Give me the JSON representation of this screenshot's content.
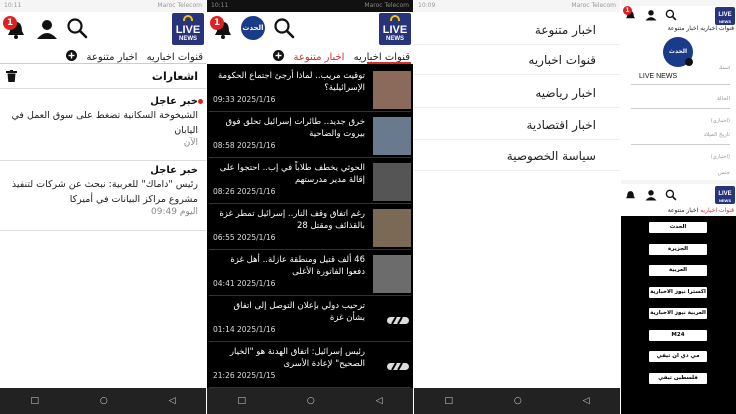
{
  "status": {
    "time1": "10:11",
    "carrier": "Maroc Telecom",
    "time3": "10:09"
  },
  "logo": {
    "line1": "LIVE",
    "line2": "NEWS"
  },
  "badge": "1",
  "tabs": {
    "varied": "اخبار متنوعة",
    "channels": "قنوات اخباريه"
  },
  "notifications": {
    "title": "اشعارات",
    "items": [
      {
        "label": "خبر عاجل",
        "body": "الشيخوخة السكانية تضغط على سوق العمل في اليابان",
        "time": "الآن"
      },
      {
        "label": "خبر عاجل",
        "body": "رئيس \"داماك\" للعربية: نبحث عن شركات لتنفيذ مشروع مراكز البيانات في أميركا",
        "time": "اليوم 09:49"
      }
    ]
  },
  "news": [
    {
      "title": "توقيت مريب.. لماذا أرجئ اجتماع الحكومة الإسرائيلية؟",
      "time": "09:33 2025/1/16",
      "thumb": "#8a6a5a"
    },
    {
      "title": "خرق جديد.. طائرات إسرائيل تحلق فوق بيروت والضاحية",
      "time": "08:58 2025/1/16",
      "thumb": "#6a7a8e"
    },
    {
      "title": "الحوثي يخطف طلاباً في إب.. احتجوا على إقالة مدير مدرستهم",
      "time": "08:26 2025/1/16",
      "thumb": "#555555"
    },
    {
      "title": "رغم اتفاق وقف النار.. إسرائيل تمطر غزة بالقذائف ومقتل 28",
      "time": "06:55 2025/1/16",
      "thumb": "#7a6a55"
    },
    {
      "title": "46 ألف قتيل ومنطقة عازلة.. أهل غزة دفعوا الفاتورة الأغلى",
      "time": "04:41 2025/1/16",
      "thumb": "#6c6c6c"
    },
    {
      "title": "ترحيب دولي بإعلان التوصل إلى اتفاق بشأن غزة",
      "time": "01:14 2025/1/16",
      "thumb": ""
    },
    {
      "title": "رئيس إسرائيل: اتفاق الهدنة هو \"الخيار الصحيح\" لإعادة الأسرى",
      "time": "21:26 2025/1/15",
      "thumb": ""
    }
  ],
  "drawer": [
    "اخبار متنوعة",
    "قنوات اخباريه",
    "اخبار رياضيه",
    "اخبار اقتصادية",
    "سياسة الخصوصية"
  ],
  "profile": {
    "logo_text": "الحدث",
    "name": "LIVE NEWS",
    "label_name": "اسمك",
    "status_label": "الحالة",
    "optional1": "(اختياري)",
    "birthdate": "تاريخ الميلاد",
    "optional2": "(اختياري)",
    "gender": "جنس"
  },
  "channels": [
    "الحدث",
    "الجزيرة",
    "العربية",
    "اكسترا نيوز الاخبارية",
    "العربية نيوز الاخبارية",
    "M24",
    "مي دي ان تيفي",
    "فلسطين تيفي"
  ]
}
